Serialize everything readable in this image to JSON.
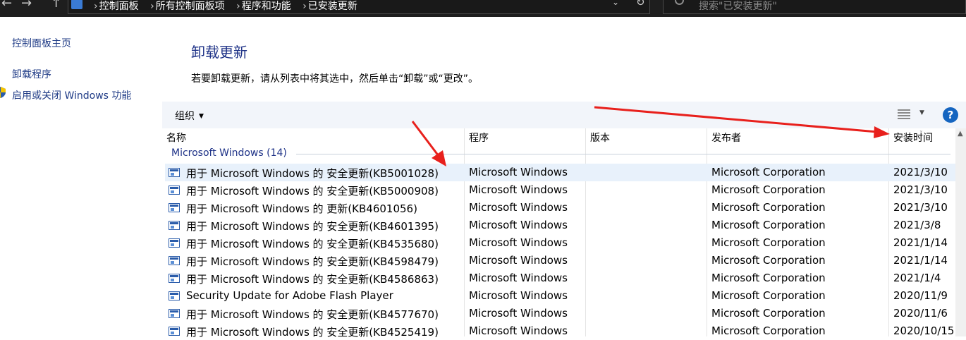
{
  "address_bar": {
    "crumbs": [
      "控制面板",
      "所有控制面板项",
      "程序和功能",
      "已安装更新"
    ],
    "search_placeholder": "搜索\"已安装更新\""
  },
  "sidebar": {
    "items": [
      {
        "label": "控制面板主页"
      },
      {
        "label": "卸载程序"
      },
      {
        "label": "启用或关闭 Windows 功能"
      }
    ]
  },
  "main": {
    "title": "卸载更新",
    "instruction": "若要卸载更新，请从列表中将其选中，然后单击“卸载”或“更改”。"
  },
  "toolbar": {
    "organize_label": "组织",
    "help_label": "?"
  },
  "list": {
    "columns": [
      "名称",
      "程序",
      "版本",
      "发布者",
      "安装时间"
    ],
    "group_label": "Microsoft Windows (14)",
    "rows": [
      {
        "name": "用于 Microsoft Windows 的 安全更新(KB5001028)",
        "program": "Microsoft Windows",
        "version": "",
        "publisher": "Microsoft Corporation",
        "date": "2021/3/10"
      },
      {
        "name": "用于 Microsoft Windows 的 安全更新(KB5000908)",
        "program": "Microsoft Windows",
        "version": "",
        "publisher": "Microsoft Corporation",
        "date": "2021/3/10"
      },
      {
        "name": "用于 Microsoft Windows 的 更新(KB4601056)",
        "program": "Microsoft Windows",
        "version": "",
        "publisher": "Microsoft Corporation",
        "date": "2021/3/10"
      },
      {
        "name": "用于 Microsoft Windows 的 安全更新(KB4601395)",
        "program": "Microsoft Windows",
        "version": "",
        "publisher": "Microsoft Corporation",
        "date": "2021/3/8"
      },
      {
        "name": "用于 Microsoft Windows 的 安全更新(KB4535680)",
        "program": "Microsoft Windows",
        "version": "",
        "publisher": "Microsoft Corporation",
        "date": "2021/1/14"
      },
      {
        "name": "用于 Microsoft Windows 的 安全更新(KB4598479)",
        "program": "Microsoft Windows",
        "version": "",
        "publisher": "Microsoft Corporation",
        "date": "2021/1/14"
      },
      {
        "name": "用于 Microsoft Windows 的 安全更新(KB4586863)",
        "program": "Microsoft Windows",
        "version": "",
        "publisher": "Microsoft Corporation",
        "date": "2021/1/4"
      },
      {
        "name": "Security Update for Adobe Flash Player",
        "program": "Microsoft Windows",
        "version": "",
        "publisher": "Microsoft Corporation",
        "date": "2020/11/9"
      },
      {
        "name": "用于 Microsoft Windows 的 安全更新(KB4577670)",
        "program": "Microsoft Windows",
        "version": "",
        "publisher": "Microsoft Corporation",
        "date": "2020/11/6"
      },
      {
        "name": "用于 Microsoft Windows 的 安全更新(KB4525419)",
        "program": "Microsoft Windows",
        "version": "",
        "publisher": "Microsoft Corporation",
        "date": "2020/10/15"
      }
    ]
  },
  "colors": {
    "link": "#1f3b86",
    "title": "#1e3287",
    "selection": "#e8f1fb",
    "toolbar_bg": "#f2f5fa",
    "annotation_arrow": "#e8201c"
  }
}
